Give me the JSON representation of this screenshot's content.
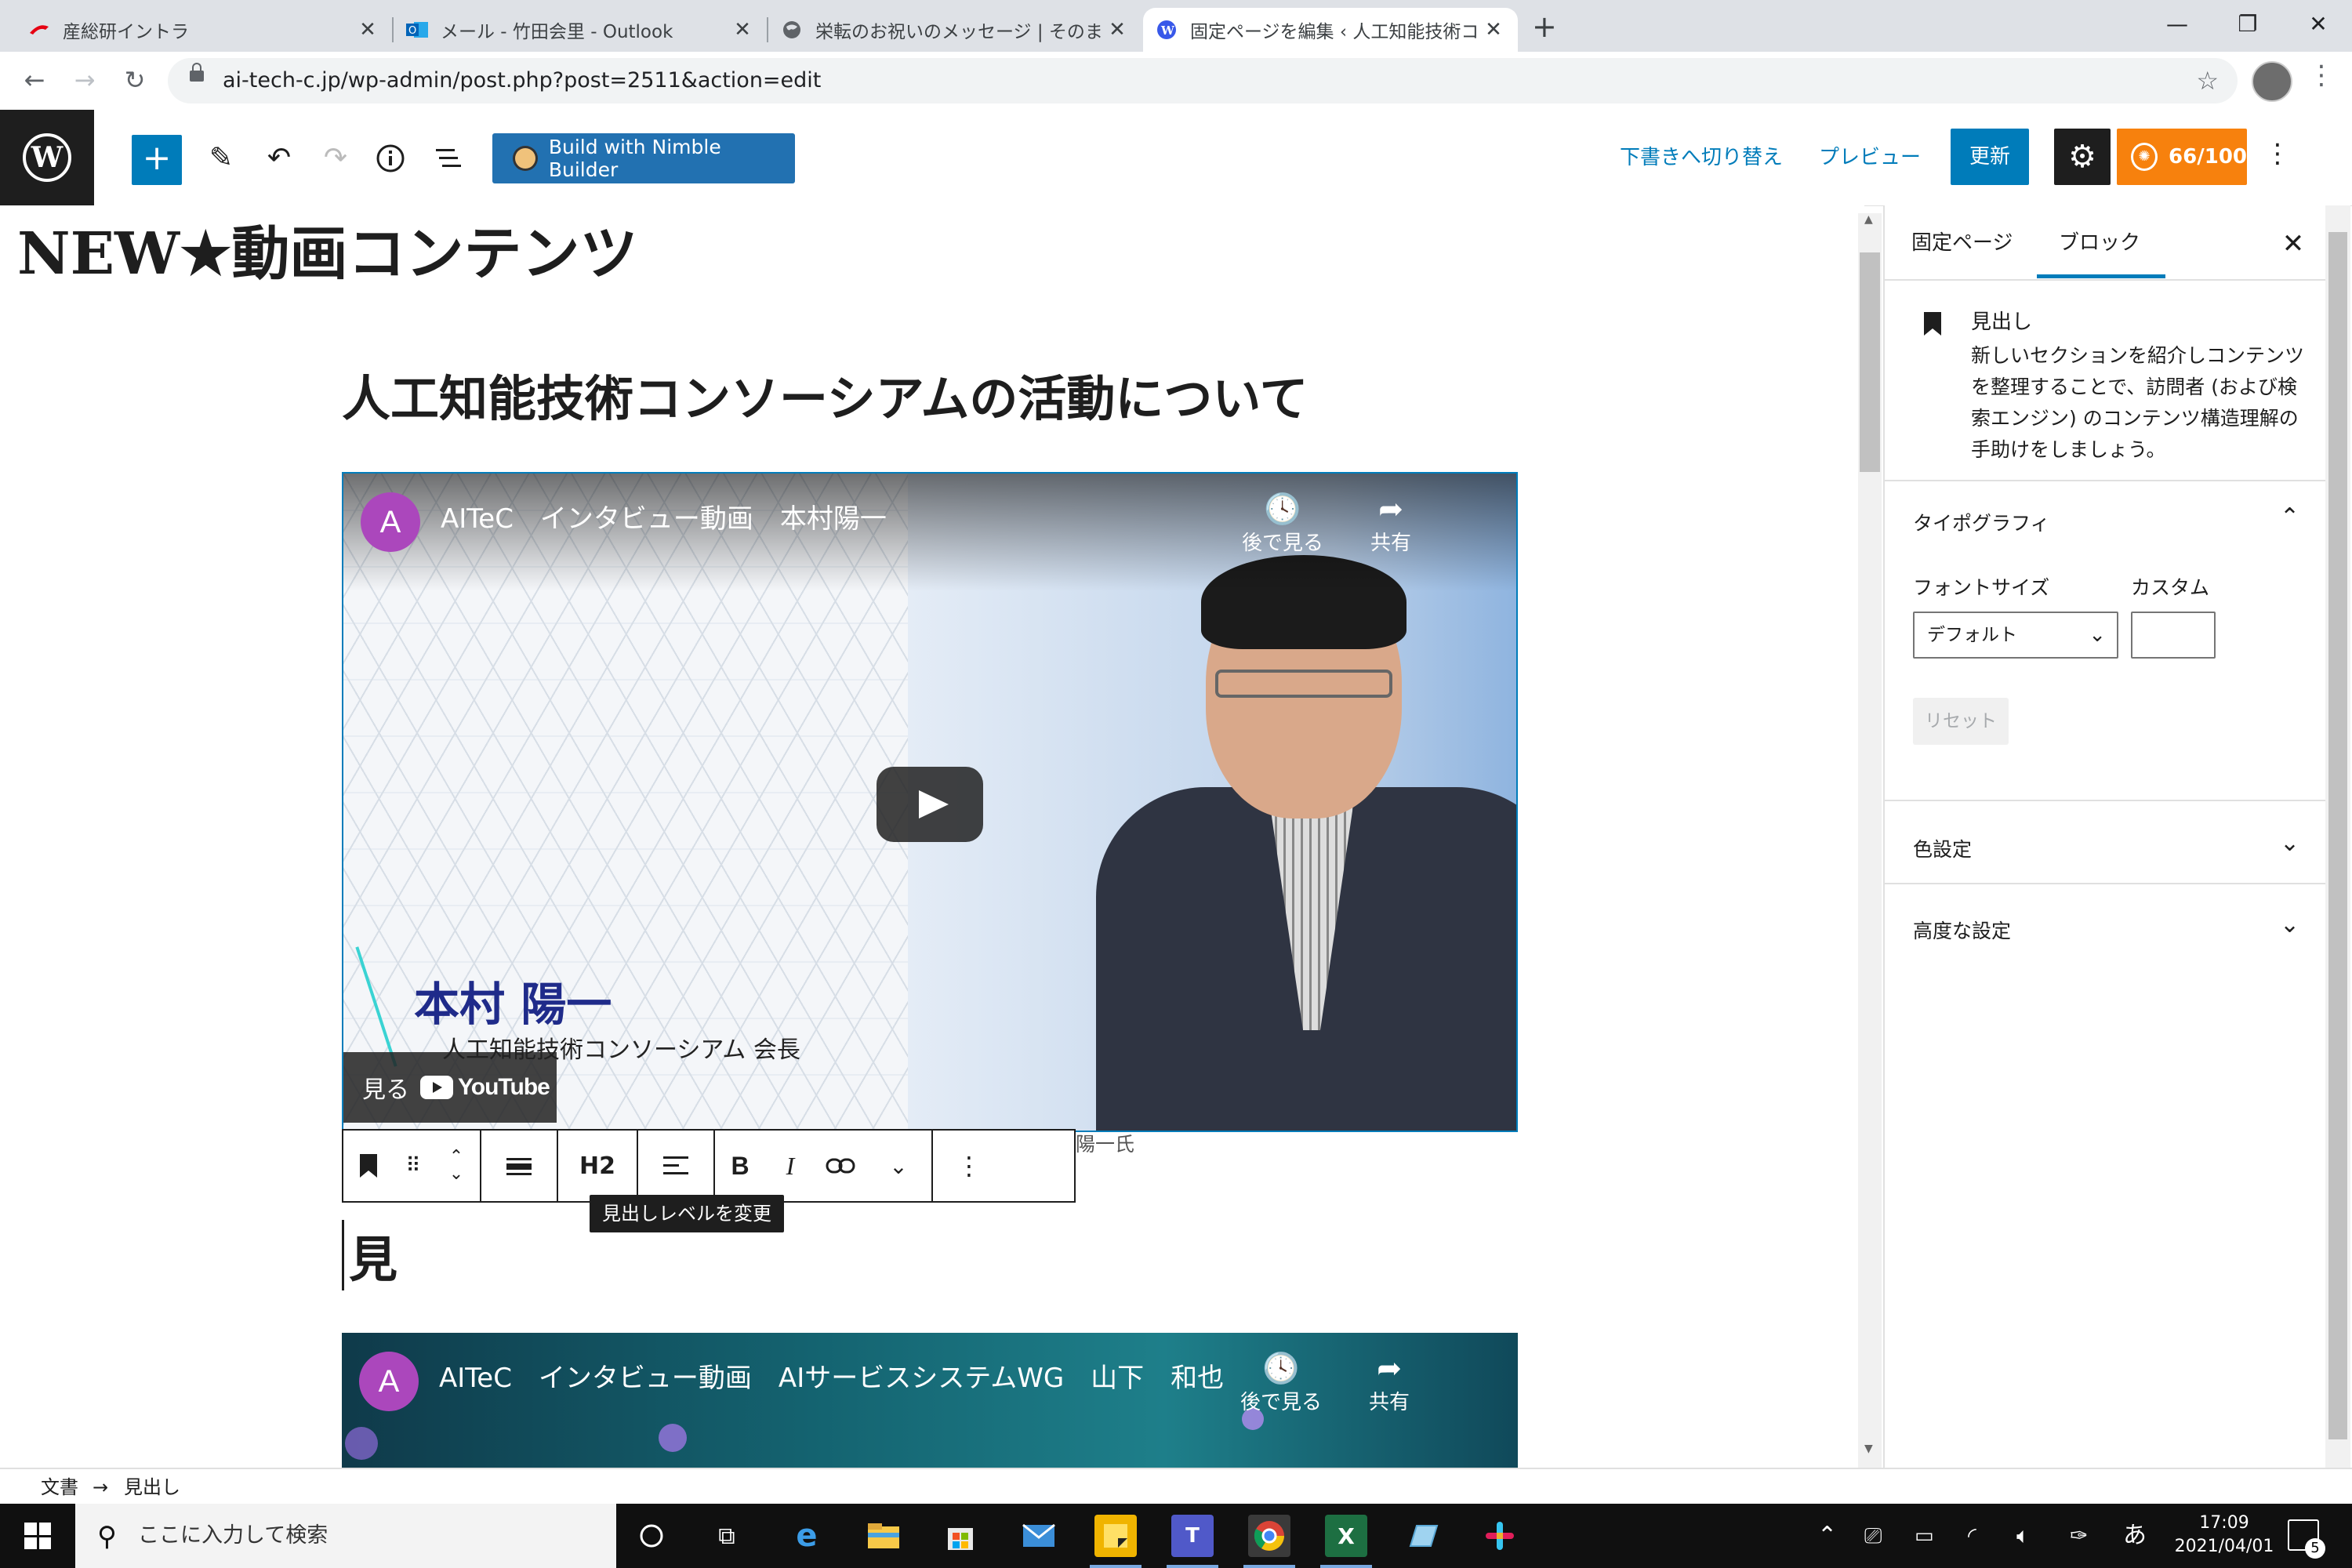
{
  "browser": {
    "tabs": [
      {
        "title": "産総研イントラ",
        "icon": "aist-icon"
      },
      {
        "title": "メール - 竹田会里 - Outlook",
        "icon": "outlook-icon"
      },
      {
        "title": "栄転のお祝いのメッセージ | そのまま",
        "icon": "globe-icon"
      },
      {
        "title": "固定ページを編集 ‹ 人工知能技術コ",
        "icon": "wordpress-icon"
      }
    ],
    "new_tab_label": "+",
    "url": "ai-tech-c.jp/wp-admin/post.php?post=2511&action=edit"
  },
  "wp_header": {
    "nimble_label": "Build with Nimble Builder",
    "switch_draft": "下書きへ切り替え",
    "preview": "プレビュー",
    "update": "更新",
    "score": "66/100",
    "accent": "#007cba",
    "score_color": "#f7810d"
  },
  "editor": {
    "post_title": "NEW★動画コンテンツ",
    "heading": "人工知能技術コンソーシアムの活動について",
    "video1": {
      "avatar_letter": "A",
      "title": "AITeC　インタビュー動画　本村陽一",
      "watch_later": "後で見る",
      "share": "共有",
      "name_caption": "本村 陽一",
      "role_caption": "人工知能技術コンソーシアム 会長",
      "watch_on": "見る",
      "youtube": "YouTube"
    },
    "caption_text": "陽一氏",
    "toolbar": {
      "heading_level": "H2",
      "bold": "B",
      "italic": "I"
    },
    "tooltip": "見出しレベルを変更",
    "typing_text": "見",
    "video2": {
      "avatar_letter": "A",
      "title": "AITeC　インタビュー動画　AIサービスシステムWG　山下　和也",
      "watch_later": "後で見る",
      "share": "共有"
    }
  },
  "sidebar": {
    "tab_page": "固定ページ",
    "tab_block": "ブロック",
    "block_name": "見出し",
    "block_desc": "新しいセクションを紹介しコンテンツを整理することで、訪問者 (および検索エンジン) のコンテンツ構造理解の手助けをしましょう。",
    "typography": "タイポグラフィ",
    "font_size_label": "フォントサイズ",
    "custom_label": "カスタム",
    "font_size_value": "デフォルト",
    "reset": "リセット",
    "color_settings": "色設定",
    "advanced": "高度な設定"
  },
  "footer": {
    "crumb1": "文書",
    "arrow": "→",
    "crumb2": "見出し"
  },
  "taskbar": {
    "search_placeholder": "ここに入力して検索",
    "time": "17:09",
    "date": "2021/04/01",
    "ime": "あ",
    "notifications": "5"
  }
}
